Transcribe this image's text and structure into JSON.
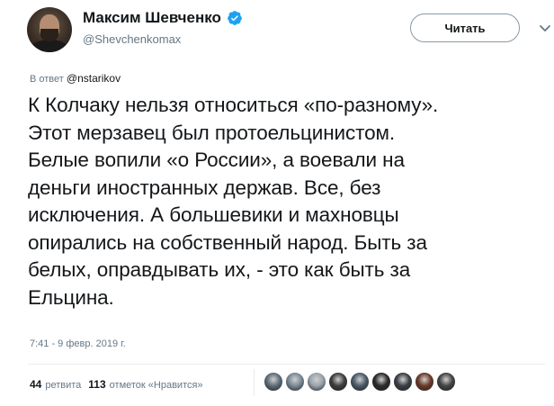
{
  "author": {
    "name": "Максим Шевченко",
    "handle": "@Shevchenkomax",
    "verified": true
  },
  "follow_button": {
    "label": "Читать"
  },
  "reply": {
    "prefix": "В ответ",
    "mention": "@nstarikov"
  },
  "tweet": {
    "lines": [
      "К Колчаку нельзя относиться «по-разному».",
      "Этот мерзавец был протоельцинистом.",
      "Белые вопили «о России», а воевали на",
      "деньги иностранных держав. Все, без",
      "исключения. А большевики и махновцы",
      "опирались на собственный народ. Быть за",
      "белых, оправдывать их, - это как быть за",
      "Ельцина."
    ],
    "timestamp": "7:41 - 9 февр. 2019 г."
  },
  "stats": {
    "retweets_count": "44",
    "retweets_label": "ретвита",
    "likes_count": "113",
    "likes_label": "отметок «Нравится»"
  },
  "likers_colors": [
    "#5d6d7a",
    "#7b8a96",
    "#9aa4ad",
    "#3d3d3d",
    "#4a5a68",
    "#2b2b2b",
    "#3a3f45",
    "#6b3a2a",
    "#444444"
  ],
  "colors": {
    "verified_blue": "#1da1f2",
    "secondary_text": "#657786"
  }
}
